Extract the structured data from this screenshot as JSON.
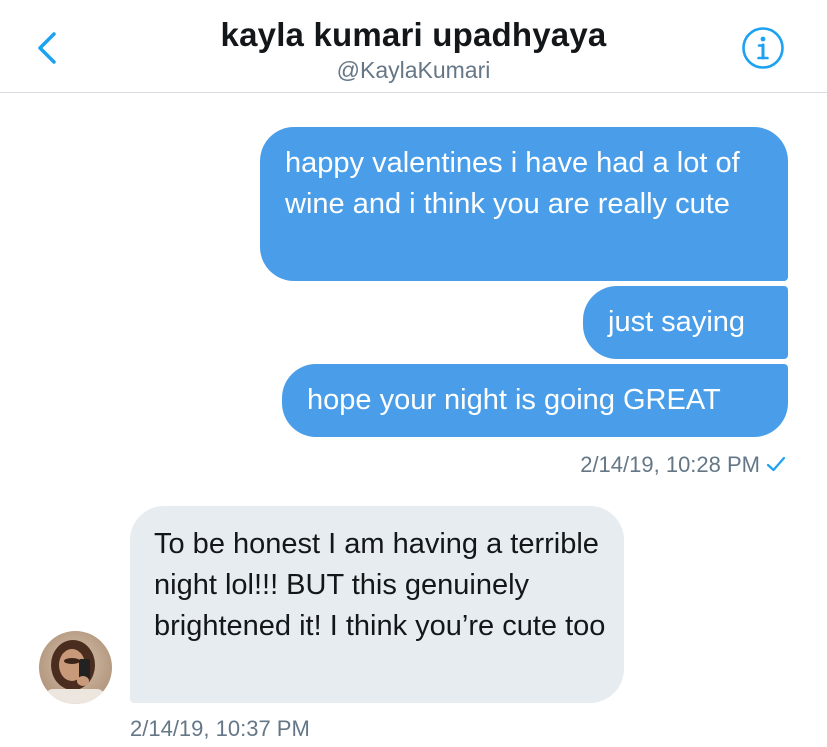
{
  "header": {
    "title": "kayla kumari upadhyaya",
    "handle": "@KaylaKumari",
    "back_icon": "chevron-left-icon",
    "info_icon": "info-circle-icon",
    "accent_color": "#1da1f2"
  },
  "messages": {
    "sent": [
      {
        "text": "happy valentines i have had a lot of wine and i think you are really cute"
      },
      {
        "text": "just saying"
      },
      {
        "text": "hope your night is going GREAT"
      }
    ],
    "sent_timestamp": "2/14/19, 10:28 PM",
    "sent_status_icon": "checkmark-icon",
    "received": [
      {
        "text": "To be honest I am having a terrible night lol!!! BUT this genuinely brightened it! I think you’re cute too"
      }
    ],
    "received_timestamp": "2/14/19, 10:37 PM"
  },
  "colors": {
    "sent_bubble": "#4a9ee9",
    "received_bubble": "#e6ecf0",
    "timestamp_text": "#657786",
    "title_text": "#14171a"
  }
}
